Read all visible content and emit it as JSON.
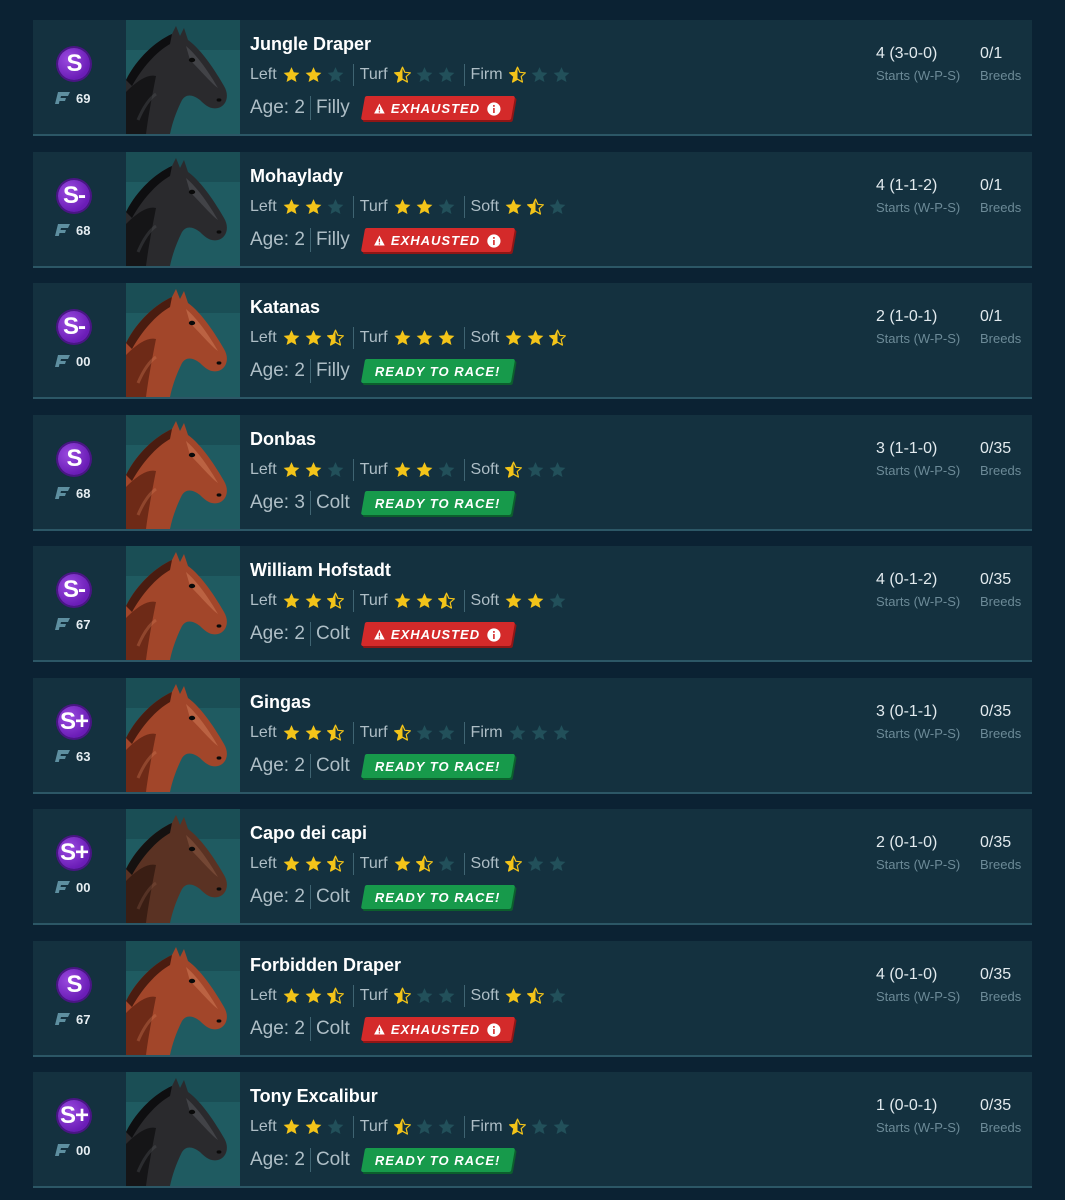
{
  "colors": {
    "star_full": "#f3c419",
    "star_empty": "#22505a",
    "exhausted": "#d42a2a",
    "ready": "#179a4b"
  },
  "icons": {
    "status_warning": "warning-triangle-icon",
    "status_info": "info-circle-icon",
    "tier": "performance-tier-icon"
  },
  "labels": {
    "starts_sub": "Starts (W-P-S)",
    "breeds_sub": "Breeds",
    "age_prefix": "Age: "
  },
  "horses": [
    {
      "name": "Jungle Draper",
      "grade": "S",
      "tier": "69",
      "coat": "dark",
      "ratings": [
        {
          "label": "Left",
          "stars": 2
        },
        {
          "label": "Turf",
          "stars": 0.5
        },
        {
          "label": "Firm",
          "stars": 0.5
        }
      ],
      "age": "Age: 2",
      "sex": "Filly",
      "status": "EXHAUSTED",
      "status_type": "exhausted",
      "starts": "4 (3-0-0)",
      "breeds": "0/1"
    },
    {
      "name": "Mohaylady",
      "grade": "S-",
      "tier": "68",
      "coat": "dark",
      "ratings": [
        {
          "label": "Left",
          "stars": 2
        },
        {
          "label": "Turf",
          "stars": 2
        },
        {
          "label": "Soft",
          "stars": 1.5
        }
      ],
      "age": "Age: 2",
      "sex": "Filly",
      "status": "EXHAUSTED",
      "status_type": "exhausted",
      "starts": "4 (1-1-2)",
      "breeds": "0/1"
    },
    {
      "name": "Katanas",
      "grade": "S-",
      "tier": "00",
      "coat": "chestnut",
      "ratings": [
        {
          "label": "Left",
          "stars": 2.5
        },
        {
          "label": "Turf",
          "stars": 3
        },
        {
          "label": "Soft",
          "stars": 2.5
        }
      ],
      "age": "Age: 2",
      "sex": "Filly",
      "status": "READY TO RACE!",
      "status_type": "ready",
      "starts": "2 (1-0-1)",
      "breeds": "0/1"
    },
    {
      "name": "Donbas",
      "grade": "S",
      "tier": "68",
      "coat": "chestnut",
      "ratings": [
        {
          "label": "Left",
          "stars": 2
        },
        {
          "label": "Turf",
          "stars": 2
        },
        {
          "label": "Soft",
          "stars": 0.5
        }
      ],
      "age": "Age: 3",
      "sex": "Colt",
      "status": "READY TO RACE!",
      "status_type": "ready",
      "starts": "3 (1-1-0)",
      "breeds": "0/35"
    },
    {
      "name": "William Hofstadt",
      "grade": "S-",
      "tier": "67",
      "coat": "chestnut",
      "ratings": [
        {
          "label": "Left",
          "stars": 2.5
        },
        {
          "label": "Turf",
          "stars": 2.5
        },
        {
          "label": "Soft",
          "stars": 2
        }
      ],
      "age": "Age: 2",
      "sex": "Colt",
      "status": "EXHAUSTED",
      "status_type": "exhausted",
      "starts": "4 (0-1-2)",
      "breeds": "0/35"
    },
    {
      "name": "Gingas",
      "grade": "S+",
      "tier": "63",
      "coat": "chestnut",
      "ratings": [
        {
          "label": "Left",
          "stars": 2.5
        },
        {
          "label": "Turf",
          "stars": 0.5
        },
        {
          "label": "Firm",
          "stars": 0
        }
      ],
      "age": "Age: 2",
      "sex": "Colt",
      "status": "READY TO RACE!",
      "status_type": "ready",
      "starts": "3 (0-1-1)",
      "breeds": "0/35"
    },
    {
      "name": "Capo dei capi",
      "grade": "S+",
      "tier": "00",
      "coat": "bay",
      "ratings": [
        {
          "label": "Left",
          "stars": 2.5
        },
        {
          "label": "Turf",
          "stars": 1.5
        },
        {
          "label": "Soft",
          "stars": 0.5
        }
      ],
      "age": "Age: 2",
      "sex": "Colt",
      "status": "READY TO RACE!",
      "status_type": "ready",
      "starts": "2 (0-1-0)",
      "breeds": "0/35"
    },
    {
      "name": "Forbidden Draper",
      "grade": "S",
      "tier": "67",
      "coat": "chestnut",
      "ratings": [
        {
          "label": "Left",
          "stars": 2.5
        },
        {
          "label": "Turf",
          "stars": 0.5
        },
        {
          "label": "Soft",
          "stars": 1.5
        }
      ],
      "age": "Age: 2",
      "sex": "Colt",
      "status": "EXHAUSTED",
      "status_type": "exhausted",
      "starts": "4 (0-1-0)",
      "breeds": "0/35"
    },
    {
      "name": "Tony Excalibur",
      "grade": "S+",
      "tier": "00",
      "coat": "dark",
      "ratings": [
        {
          "label": "Left",
          "stars": 2
        },
        {
          "label": "Turf",
          "stars": 0.5
        },
        {
          "label": "Firm",
          "stars": 0.5
        }
      ],
      "age": "Age: 2",
      "sex": "Colt",
      "status": "READY TO RACE!",
      "status_type": "ready",
      "starts": "1 (0-0-1)",
      "breeds": "0/35"
    }
  ]
}
